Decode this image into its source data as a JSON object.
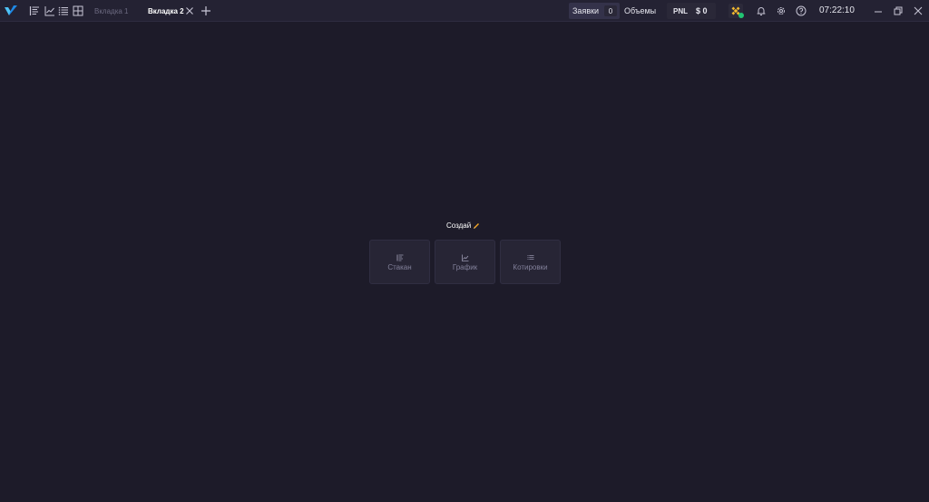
{
  "app": {
    "logo_icon": "app-logo-icon",
    "accent_color": "#1e88e5"
  },
  "toolbar": {
    "icons": [
      "orderbook-icon",
      "chart-icon",
      "quotes-list-icon",
      "layout-grid-icon"
    ]
  },
  "tabs": [
    {
      "label": "Вкладка 1",
      "active": false
    },
    {
      "label": "Вкладка 2",
      "active": true
    }
  ],
  "header": {
    "orders_label": "Заявки",
    "orders_count": "0",
    "volumes_label": "Объемы",
    "pnl_label": "PNL",
    "pnl_value": "$ 0",
    "exchange_icon": "binance-icon",
    "status_color": "#21c472",
    "clock": "07:22:10"
  },
  "main": {
    "create_label": "Создай",
    "create_emoji": "pencil-emoji",
    "widgets": [
      {
        "label": "Стакан",
        "icon": "orderbook-icon"
      },
      {
        "label": "График",
        "icon": "chart-icon"
      },
      {
        "label": "Котировки",
        "icon": "quotes-list-icon"
      }
    ]
  }
}
